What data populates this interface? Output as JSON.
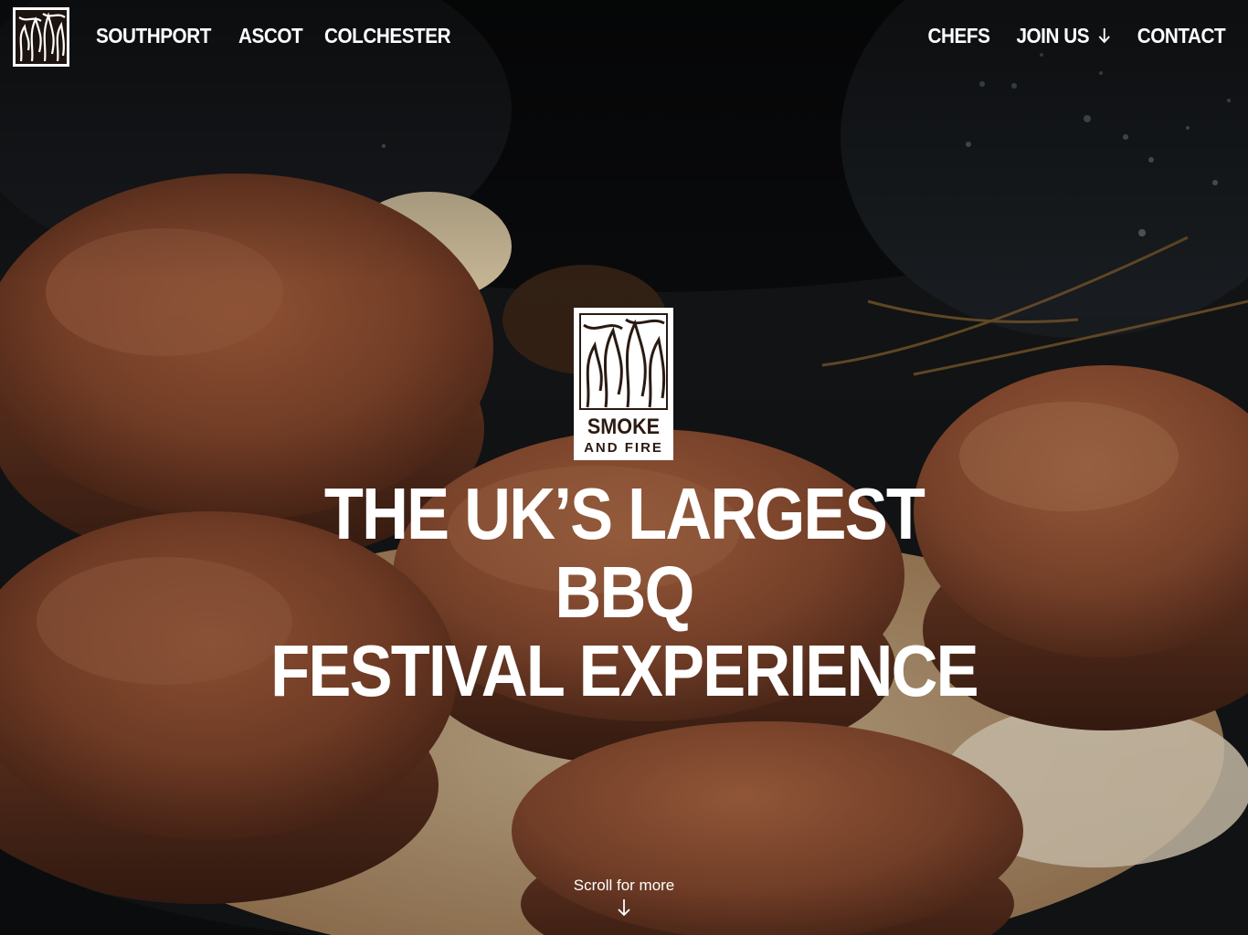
{
  "nav": {
    "left_links": [
      "SOUTHPORT",
      "ASCOT",
      "COLCHESTER"
    ],
    "right_links": {
      "chefs": "CHEFS",
      "join_us": "JOIN US",
      "contact": "CONTACT"
    },
    "brand_icon": "flame-woodcut-icon",
    "join_icon": "arrow-down-icon"
  },
  "hero": {
    "logo_line1": "SMOKE",
    "logo_line2": "AND FIRE",
    "headline_line1": "THE UK’S LARGEST BBQ",
    "headline_line2": "FESTIVAL EXPERIENCE",
    "scroll_label": "Scroll for more",
    "scroll_icon": "arrow-down-icon"
  },
  "colors": {
    "text": "#ffffff",
    "logo_ink": "#2a1a12",
    "meat": "#8a4a2e",
    "pan": "#101214"
  }
}
